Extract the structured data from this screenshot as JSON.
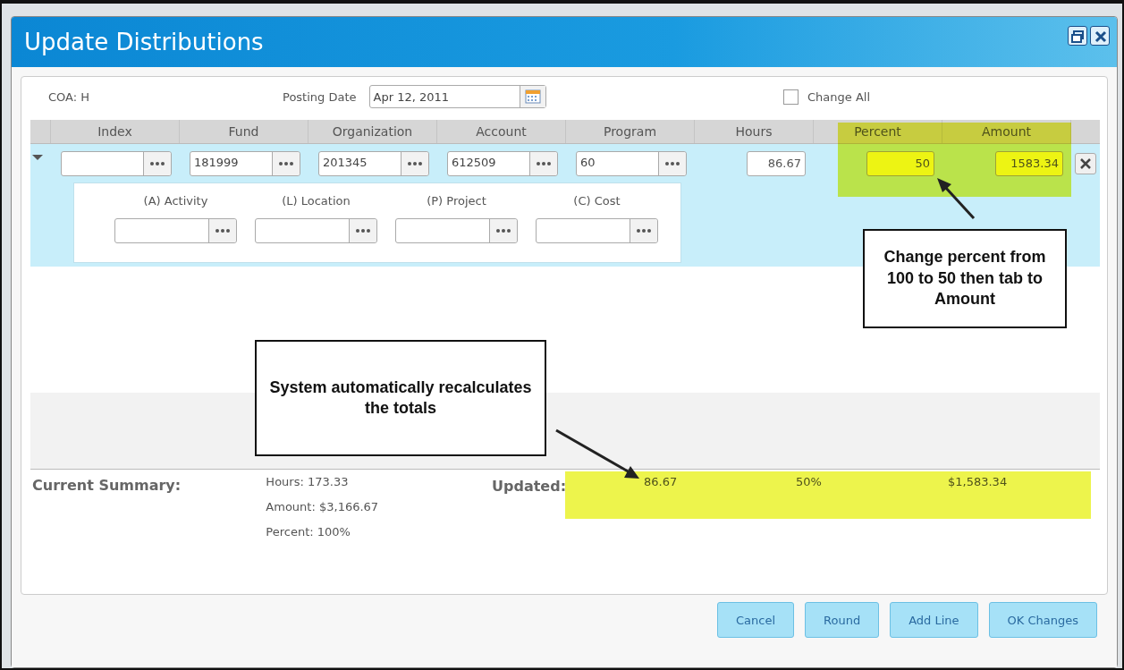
{
  "window": {
    "title": "Update Distributions"
  },
  "coa": "COA: H",
  "posting_date": {
    "label": "Posting Date",
    "value": "Apr 12, 2011"
  },
  "change_all": {
    "label": "Change All",
    "checked": false
  },
  "table": {
    "columns": [
      "Index",
      "Fund",
      "Organization",
      "Account",
      "Program",
      "Hours",
      "Percent",
      "Amount"
    ],
    "rows": [
      {
        "expanded": true,
        "cells": [
          {
            "kind": "lookup",
            "highlighted": false
          },
          {
            "kind": "lookup",
            "value": "181999",
            "highlighted": false
          },
          {
            "kind": "lookup",
            "value": "201345",
            "highlighted": false
          },
          {
            "kind": "lookup",
            "value": "612509",
            "highlighted": false
          },
          {
            "kind": "lookup",
            "value": "60",
            "highlighted": false
          },
          {
            "kind": "number",
            "value": "86.67",
            "highlighted": false
          },
          {
            "kind": "number",
            "value": "50",
            "highlighted": true
          },
          {
            "kind": "number",
            "value": "1583.34",
            "highlighted": true
          }
        ],
        "sub_fields": [
          {
            "label": "(A) Activity"
          },
          {
            "label": "(L) Location"
          },
          {
            "label": "(P) Project"
          },
          {
            "label": "(C) Cost"
          }
        ]
      }
    ]
  },
  "summary": {
    "title": "Current Summary:",
    "lines": [
      "Hours: 173.33",
      "Amount: $3,166.67",
      "Percent: 100%"
    ]
  },
  "updated": {
    "label": "Updated:",
    "values": [
      "86.67",
      "50%",
      "$1,583.34"
    ]
  },
  "buttons": [
    "Cancel",
    "Round",
    "Add Line",
    "OK Changes"
  ],
  "annotations": [
    {
      "text": "Change percent from 100 to 50 then tab to Amount"
    },
    {
      "text": "System automatically recalculates the totals"
    }
  ]
}
